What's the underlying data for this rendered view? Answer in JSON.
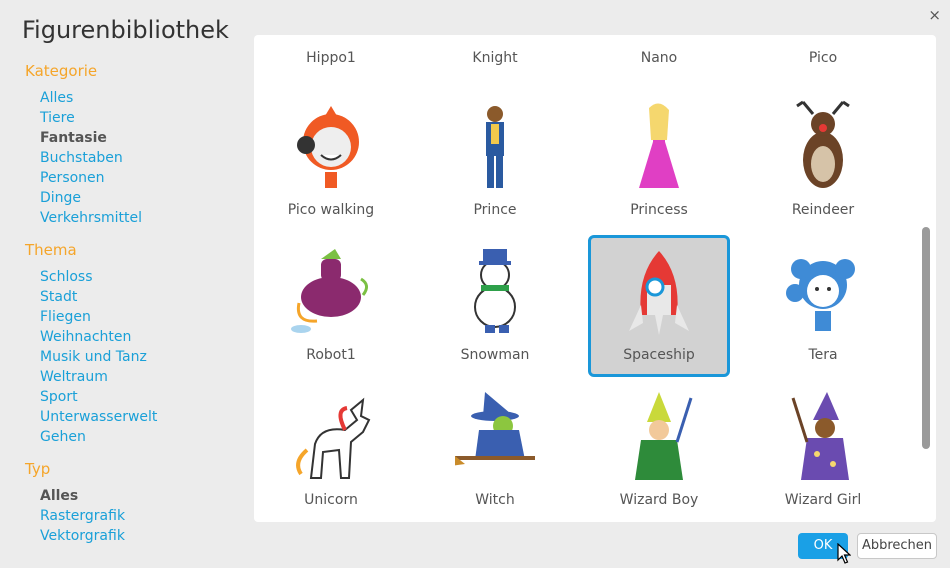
{
  "dialog": {
    "title": "Figurenbibliothek",
    "close_symbol": "×"
  },
  "sidebar": {
    "sections": [
      {
        "heading": "Kategorie",
        "items": [
          "Alles",
          "Tiere",
          "Fantasie",
          "Buchstaben",
          "Personen",
          "Dinge",
          "Verkehrsmittel"
        ],
        "active": "Fantasie"
      },
      {
        "heading": "Thema",
        "items": [
          "Schloss",
          "Stadt",
          "Fliegen",
          "Weihnachten",
          "Musik und Tanz",
          "Weltraum",
          "Sport",
          "Unterwasserwelt",
          "Gehen"
        ],
        "active": ""
      },
      {
        "heading": "Typ",
        "items": [
          "Alles",
          "Rastergrafik",
          "Vektorgrafik"
        ],
        "active": "Alles"
      }
    ]
  },
  "library": {
    "partial_row": [
      "Hippo1",
      "Knight",
      "Nano",
      "Pico"
    ],
    "rows": [
      [
        "Pico walking",
        "Prince",
        "Princess",
        "Reindeer"
      ],
      [
        "Robot1",
        "Snowman",
        "Spaceship",
        "Tera"
      ],
      [
        "Unicorn",
        "Witch",
        "Wizard Boy",
        "Wizard Girl"
      ]
    ],
    "selected": "Spaceship"
  },
  "buttons": {
    "ok": "OK",
    "cancel": "Abbrechen"
  },
  "colors": {
    "accent_blue": "#1aa0e6",
    "heading_orange": "#f5a52a",
    "link_blue": "#1aa0d8"
  }
}
